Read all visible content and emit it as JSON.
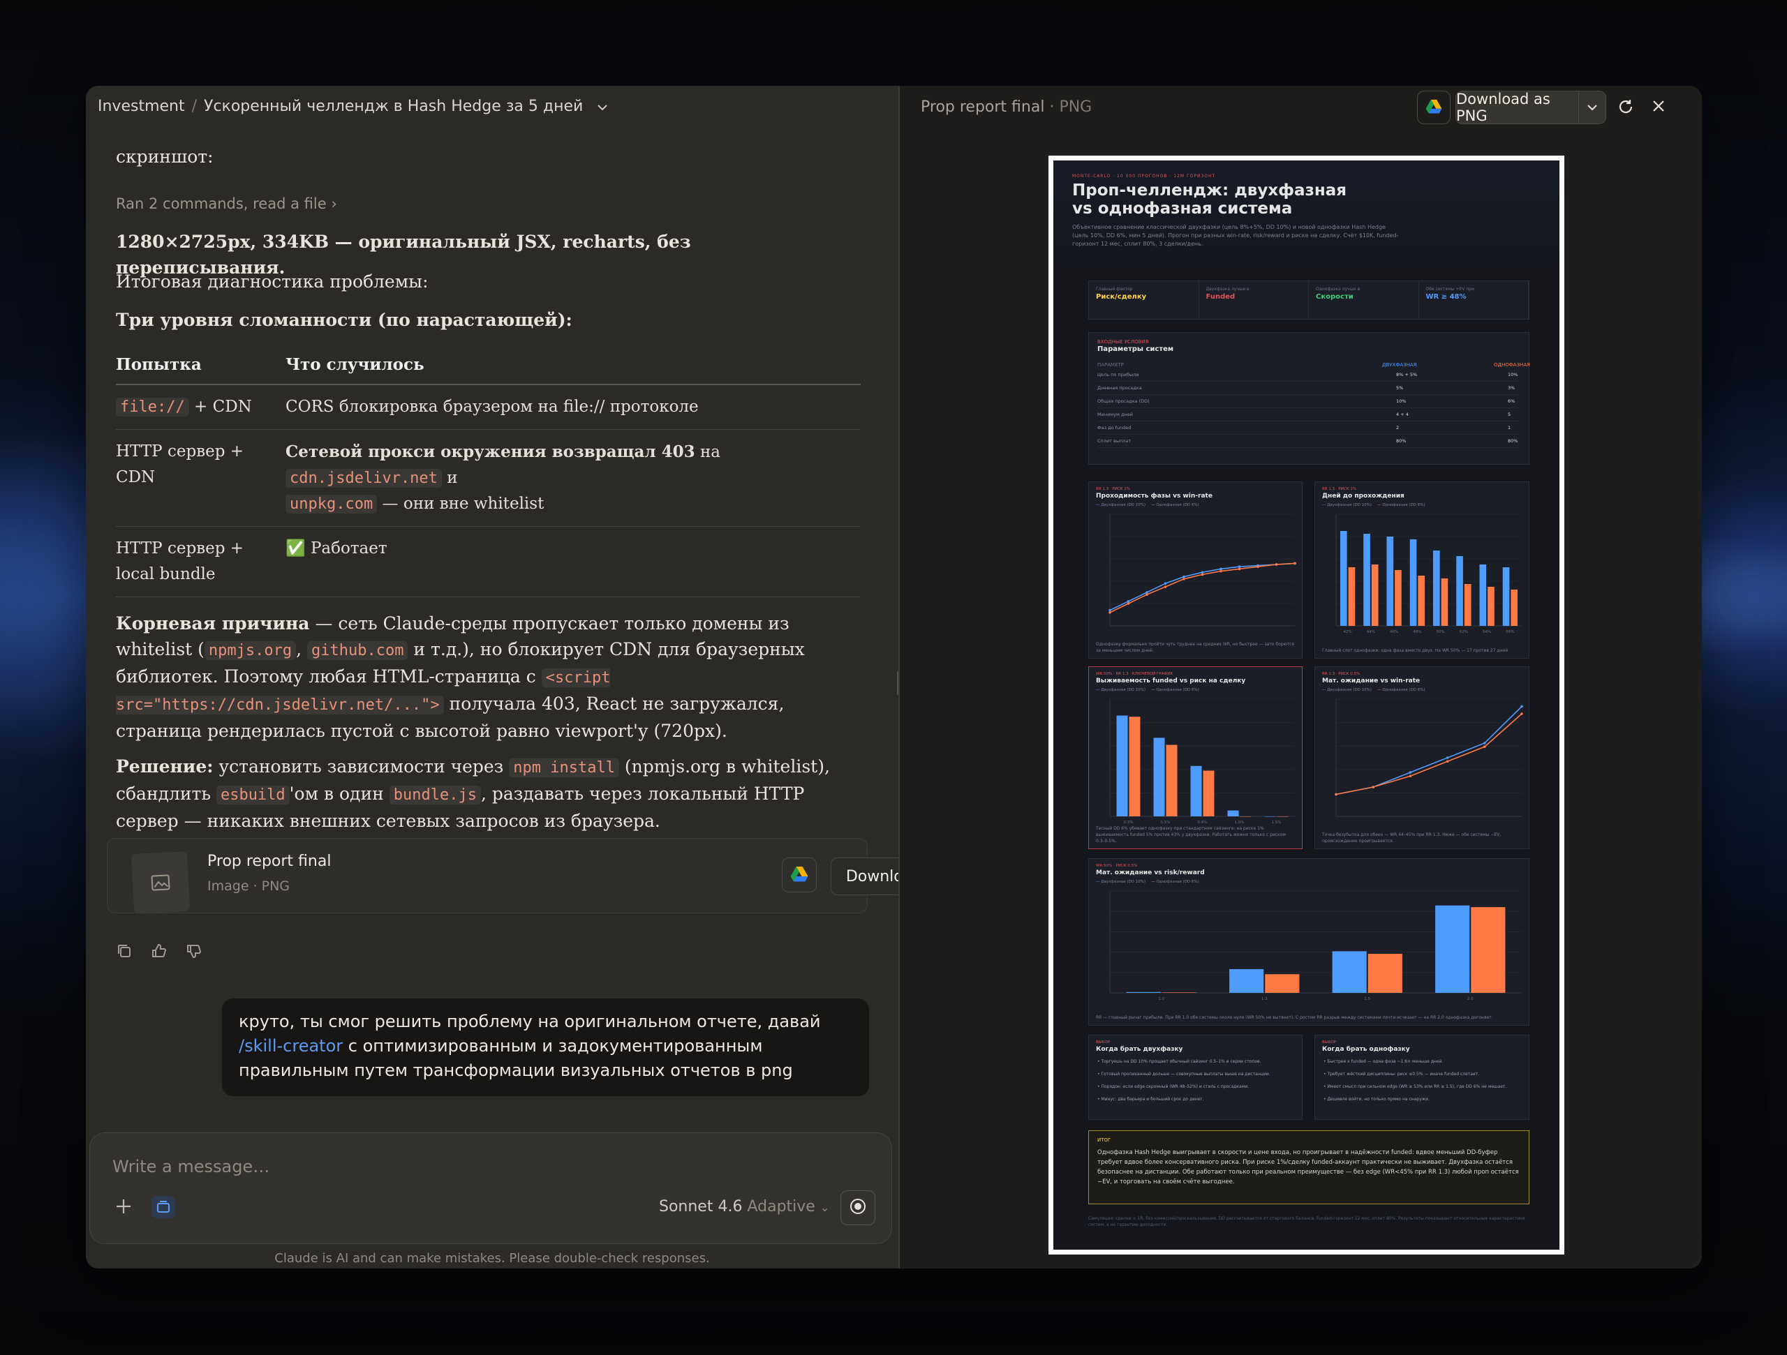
{
  "breadcrumb": {
    "project": "Investment",
    "sep": "/",
    "chat": "Ускоренный челлендж в Hash Hedge за 5 дней"
  },
  "messages": {
    "cut_line": "скриншот:",
    "ran": "Ran 2 commands, read a file",
    "size_line": "1280×2725px, 334KB — оригинальный JSX, recharts, без переписывания.",
    "diag_title": "Итоговая диагностика проблемы:",
    "levels_title": "Три уровня сломанности (по нарастающей):",
    "table": {
      "headers": [
        "Попытка",
        "Что случилось"
      ],
      "r1_code": "file://",
      "r1_rest": " + CDN",
      "r1_result": "CORS блокировка браузером на file:// протоколе",
      "r2_attempt": "HTTP сервер + CDN",
      "r2_bold": "Сетевой прокси окружения возвращал 403",
      "r2_on": " на ",
      "r2_c1": "cdn.jsdelivr.net",
      "r2_and": " и ",
      "r2_c2": "unpkg.com",
      "r2_tail": " — они вне whitelist",
      "r3_attempt": "HTTP сервер + local bundle",
      "r3_icon": "✅",
      "r3_result": "Работает"
    },
    "root_bold": "Корневая причина",
    "root_a": " — сеть Claude-среды пропускает только домены из whitelist (",
    "root_c1": "npmjs.org",
    "root_comma": ", ",
    "root_c2": "github.com",
    "root_b": " и т.д.), но блокирует CDN для браузерных библиотек. Поэтому любая HTML-страница с ",
    "root_c3": "<script src=\"https://cdn.jsdelivr.net/...\">",
    "root_c": " получала 403, React не загружался, страница рендерилась пустой с высотой равно viewport'у (720px).",
    "sol_bold": "Решение:",
    "sol_a": " установить зависимости через ",
    "sol_c1": "npm install",
    "sol_b": " (npmjs.org в whitelist), сбандлить ",
    "sol_c2": "esbuild",
    "sol_c": "'ом в один ",
    "sol_c3": "bundle.js",
    "sol_d": ", раздавать через локальный HTTP сервер — никаких внешних сетевых запросов из браузера."
  },
  "attachment": {
    "title": "Prop report final",
    "meta": "Image · PNG",
    "download": "Download"
  },
  "user_msg": {
    "a": "круто, ты смог решить проблему на оригинальном отчете, давай ",
    "link": "/skill-creator",
    "b": " с оптимизированным и задокументированным правильным путем трансформации визуальных отчетов в png"
  },
  "composer": {
    "placeholder": "Write a message…",
    "model": "Sonnet 4.6",
    "mode": "Adaptive"
  },
  "disclaimer": "Claude is AI and can make mistakes. Please double-check responses.",
  "preview": {
    "title": "Prop report final",
    "type": "· PNG",
    "download": "Download as PNG"
  },
  "report": {
    "kicker": "MONTE-CARLO · 10 000 ПРОГОНОВ · 12М ГОРИЗОНТ",
    "title1": "Проп-челлендж: двухфазная",
    "title2": "vs однофазная система",
    "intro": "Объективное сравнение классической двухфазки (цель 8%+5%, DD 10%) и новой однофазки Hash Hedge (цель 10%, DD 6%, мин 5 дней). Прогон при разных win-rate, risk/reward и риске на сделку. Счёт $10K, funded-горизонт 12 мес, сплит 80%, 3 сделки/день.",
    "kpis": [
      {
        "k": "Главный фактор",
        "v": "Риск/сделку",
        "c": "#ffd23f"
      },
      {
        "k": "Двухфазка лучше в",
        "v": "Funded",
        "c": "#e0525a"
      },
      {
        "k": "Однофазка лучше в",
        "v": "Скорости",
        "c": "#3fd07a"
      },
      {
        "k": "Обе системы +EV при",
        "v": "WR ≥ 48%",
        "c": "#4f9cff"
      }
    ],
    "params_kicker": "ВХОДНЫЕ УСЛОВИЯ",
    "params_title": "Параметры систем",
    "params_head": [
      "ПАРАМЕТР",
      "ДВУХФАЗНАЯ",
      "ОДНОФАЗНАЯ"
    ],
    "params": [
      [
        "Цель по прибыли",
        "8% + 5%",
        "10%"
      ],
      [
        "Дневная просадка",
        "5%",
        "3%"
      ],
      [
        "Общая просадка (DD)",
        "10%",
        "6%"
      ],
      [
        "Минимум дней",
        "4 + 4",
        "5"
      ],
      [
        "Фаз до funded",
        "2",
        "1"
      ],
      [
        "Сплит выплат",
        "80%",
        "80%"
      ]
    ],
    "legend_two": "Двухфазная (DD 10%)",
    "legend_one": "Однофазная (DD 6%)",
    "c1": {
      "kicker": "RR 1.3 · РИСК 1%",
      "title": "Проходимость фазы vs win-rate",
      "note": "Однофазку формально пройти чуть труднее на средних WR, но быстрее — зато борются за меньшим числом дней."
    },
    "c2": {
      "kicker": "RR 1.3 · РИСК 1%",
      "title": "Дней до прохождения",
      "note": "Главный слот однофазки: одна фаза вместо двух. На WR 50% — 17 против 27 дней"
    },
    "c3": {
      "kicker": "WR 50% · RR 1.3 · КЛЮЧЕВОЙ ГРАФИК",
      "title": "Выживаемость funded vs риск на сделку",
      "note": "Тесный DD 6% убивает однофазку при стандартном сайзинге: на риске 1% выживаемость funded 5% против 43% у двухфазки. Работать можно только с риском 0.3–0.5%."
    },
    "c4": {
      "kicker": "RR 1.3 · РИСК 0.5%",
      "title": "Мат. ожидание vs win-rate",
      "note": "Точка безубытка для обеих — WR 44–45% при RR 1.3. Ниже — обе системы −EV, происхождение проигрывается."
    },
    "c5": {
      "kicker": "WR 50% · РИСК 0.5%",
      "title": "Мат. ожидание vs risk/reward",
      "note": "RR — главный рычаг прибыли. При RR 1.0 обе системы около нуля (WR 50% не вытянет). С ростом RR разрыв между системами почти исчезает — на RR 2.0 однофазка догоняет."
    },
    "w1": {
      "kicker": "ВЫБОР",
      "title": "Когда брать двухфазку",
      "items": [
        "Торгуешь на DD 10% прощает обычный сайзинг 0.5–1% и серии стопов.",
        "Готовый пропиханный дольше — совокупные выплаты выше на дистанции.",
        "Порядок: если edge скромный (WR 48–52%) и стиль с просадками.",
        "Минус: два барьера и больший срок до денег."
      ]
    },
    "w2": {
      "kicker": "ВЫБОР",
      "title": "Когда брать однофазку",
      "items": [
        "Быстрее к funded — одна фаза ~1.6× меньше дней.",
        "Требует жёсткий дисциплины: риск ≤0.5% — иначе funded слетает.",
        "Имеет смысл при сильном edge (WR ≥ 53% или RR ≥ 1.5), где DD 6% не мешает.",
        "Дешевле войти, но только прямо на снаружи."
      ]
    },
    "verdict_kicker": "ИТОГ",
    "verdict": "Однофазка Hash Hedge выигрывает в скорости и цене входа, но проигрывает в надёжности funded: вдвое меньший DD-буфер требует вдвое более консервативного риска. При риске 1%/сделку funded-аккаунт практически не выживает. Двухфазка остаётся безопаснее на дистанции. Обе работают только при реальном преимуществе — без edge (WR<45% при RR 1.3) любой проп остаётся −EV, и торговать на своём счёте выгоднее.",
    "footer": "Симуляция: сделки ± 1R, без комиссий/проскальзывания, DD рассчитывается от стартового баланса. Funded-горизонт 12 мес, сплит 80%. Результаты показывают относительные характеристики систем, а не гарантию доходности."
  },
  "chart_data": [
    {
      "type": "line",
      "title": "Проходимость фазы vs win-rate",
      "x": [
        40,
        42,
        44,
        46,
        48,
        50,
        52,
        54,
        56,
        58,
        60
      ],
      "series": [
        {
          "name": "Двухфазная (DD 10%)",
          "values": [
            14,
            22,
            30,
            38,
            44,
            48,
            51,
            53,
            54,
            55,
            56
          ]
        },
        {
          "name": "Однофазная (DD 6%)",
          "values": [
            12,
            20,
            28,
            35,
            42,
            46,
            49,
            51,
            53,
            55,
            56
          ]
        }
      ],
      "ylim": [
        0,
        100
      ]
    },
    {
      "type": "bar",
      "title": "Дней до прохождения",
      "categories": [
        "42%",
        "44%",
        "46%",
        "48%",
        "50%",
        "52%",
        "54%",
        "56%"
      ],
      "series": [
        {
          "name": "Двухфазная (DD 10%)",
          "values": [
            34,
            33,
            32,
            31,
            27,
            25,
            22,
            21
          ]
        },
        {
          "name": "Однофазная (DD 6%)",
          "values": [
            21,
            22,
            20,
            18,
            17,
            15,
            14,
            13
          ]
        }
      ]
    },
    {
      "type": "bar",
      "title": "Выживаемость funded vs риск на сделку",
      "categories": [
        "0.3%",
        "0.5%",
        "0.8%",
        "1.0%",
        "1.5%"
      ],
      "series": [
        {
          "name": "Двухфазная (DD 10%)",
          "values": [
            86,
            67,
            43,
            5,
            0
          ]
        },
        {
          "name": "Однофазная (DD 6%)",
          "values": [
            85,
            61,
            39,
            0,
            0
          ]
        }
      ],
      "ylim": [
        0,
        100
      ]
    },
    {
      "type": "line",
      "title": "Мат. ожидание vs win-rate",
      "x": [
        40,
        44,
        48,
        52,
        56,
        60
      ],
      "series": [
        {
          "name": "Двухфазная (DD 10%)",
          "values": [
            -1,
            0,
            2,
            4,
            6,
            11
          ]
        },
        {
          "name": "Однофазная (DD 6%)",
          "values": [
            -1,
            0,
            1.5,
            3.5,
            5.5,
            10
          ]
        }
      ]
    },
    {
      "type": "bar",
      "title": "Мат. ожидание vs risk/reward",
      "categories": [
        "1.0",
        "1.3",
        "1.5",
        "2.0"
      ],
      "series": [
        {
          "name": "Двухфазная (DD 10%)",
          "values": [
            0.1,
            2.8,
            4.9,
            10.3
          ]
        },
        {
          "name": "Однофазная (DD 6%)",
          "values": [
            0.05,
            2.2,
            4.6,
            10.1
          ]
        }
      ]
    }
  ]
}
